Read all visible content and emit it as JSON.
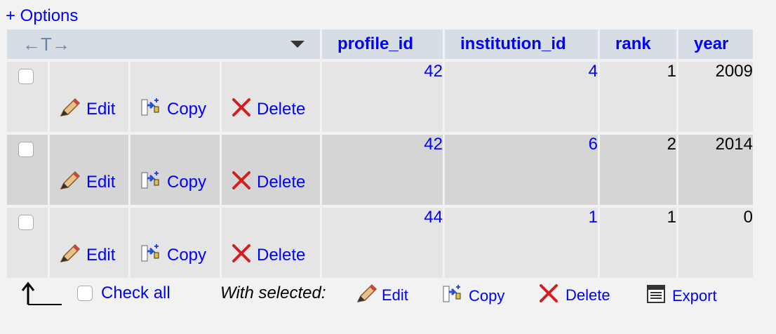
{
  "options_label": "+ Options",
  "columns": {
    "profile_id": "profile_id",
    "institution_id": "institution_id",
    "rank": "rank",
    "year": "year"
  },
  "actions": {
    "edit": "Edit",
    "copy": "Copy",
    "delete": "Delete"
  },
  "rows": [
    {
      "profile_id": "42",
      "institution_id": "4",
      "rank": "1",
      "year": "2009"
    },
    {
      "profile_id": "42",
      "institution_id": "6",
      "rank": "2",
      "year": "2014"
    },
    {
      "profile_id": "44",
      "institution_id": "1",
      "rank": "1",
      "year": "0"
    }
  ],
  "footer": {
    "check_all": "Check all",
    "with_selected": "With selected:",
    "edit": "Edit",
    "copy": "Copy",
    "delete": "Delete",
    "export": "Export"
  },
  "colors": {
    "link": "#0000ff",
    "header_bg": "#d6dde4",
    "row_light": "#e5e5e5",
    "row_dark": "#d5d5d5"
  }
}
